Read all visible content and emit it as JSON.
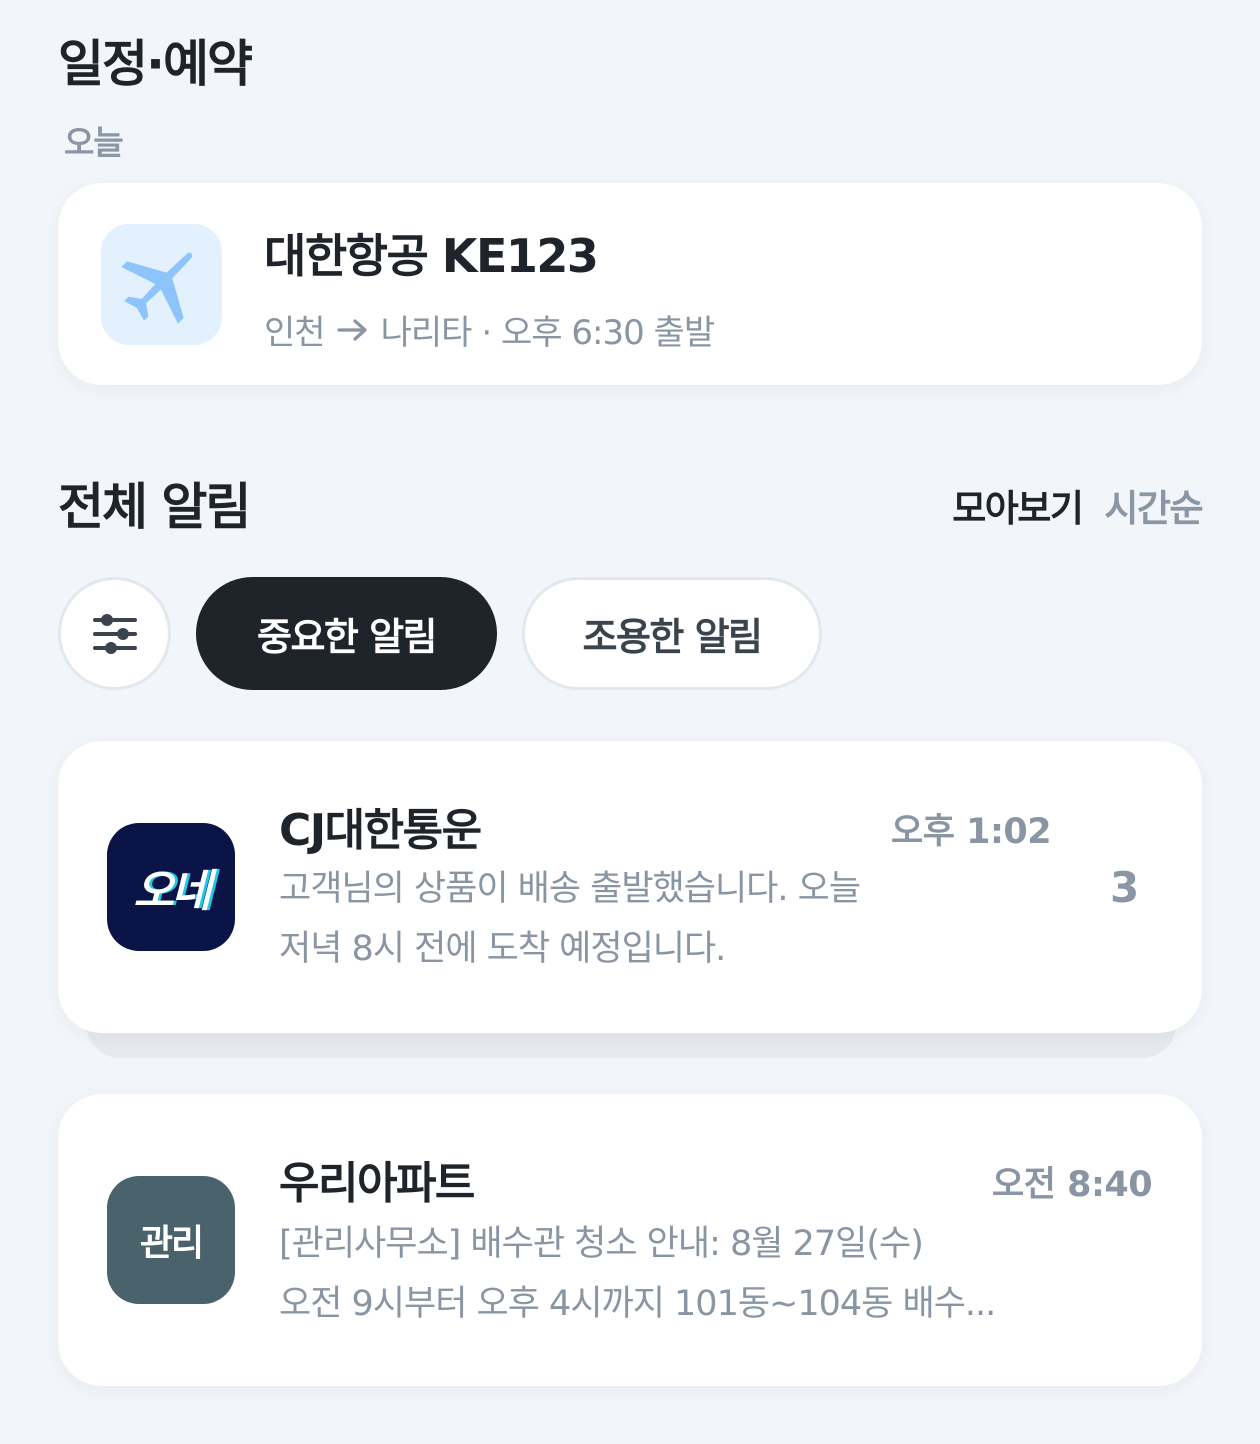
{
  "schedule": {
    "title": "일정·예약",
    "today_label": "오늘",
    "flight": {
      "icon": "airplane-icon",
      "title": "대한항공 KE123",
      "from": "인천",
      "to": "나리타",
      "detail": "· 오후 6:30 출발"
    }
  },
  "notifications": {
    "title": "전체 알림",
    "view_modes": {
      "grouped": "모아보기",
      "chronological": "시간순",
      "active": "grouped"
    },
    "chips": {
      "filter_icon": "sliders-icon",
      "important": "중요한 알림",
      "quiet": "조용한 알림",
      "selected": "important"
    },
    "items": [
      {
        "app_name": "CJ대한통운",
        "icon_text": "오네",
        "icon_color": "#0a1446",
        "time": "오후 1:02",
        "body_line1": "고객님의 상품이 배송 출발했습니다. 오늘",
        "body_line2": "저녁 8시 전에 도착 예정입니다.",
        "count": "3"
      },
      {
        "app_name": "우리아파트",
        "icon_text": "관리",
        "icon_color": "#4a626b",
        "time": "오전 8:40",
        "body_line1": "[관리사무소] 배수관 청소 안내: 8월 27일(수)",
        "body_line2": "오전 9시부터 오후 4시까지 101동~104동 배수..."
      }
    ]
  },
  "colors": {
    "background": "#f2f5f9",
    "card": "#ffffff",
    "primary_text": "#1f232a",
    "secondary_text": "#8a95a3",
    "chip_active": "#1f232a",
    "flight_icon_bg": "#e3f1fe",
    "flight_icon": "#8cc4fb"
  }
}
